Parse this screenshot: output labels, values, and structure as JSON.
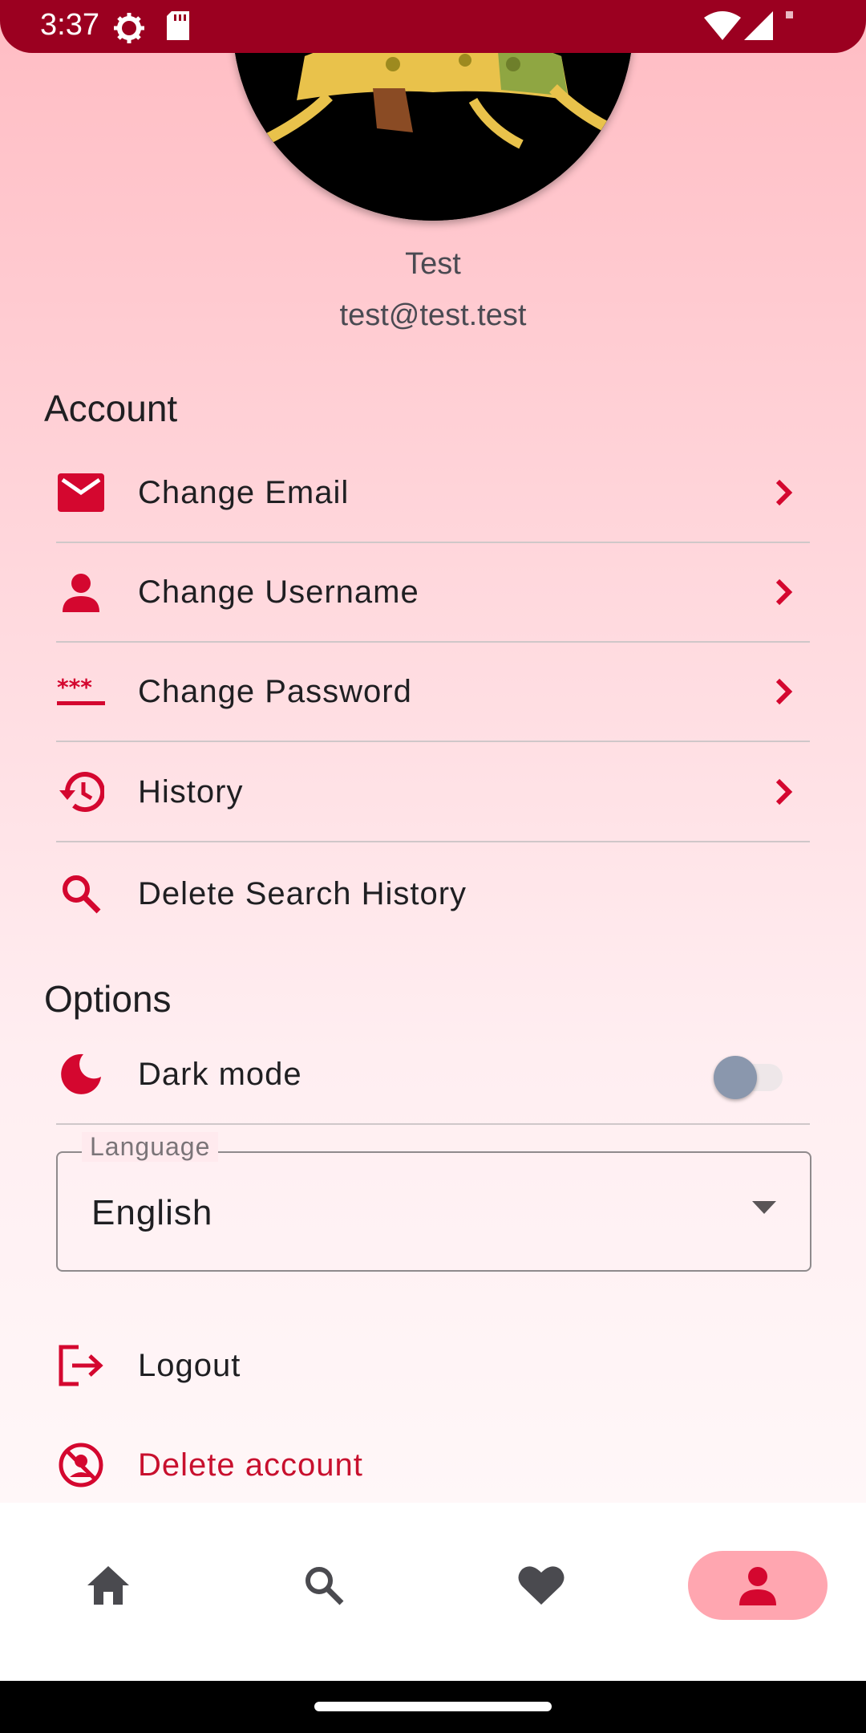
{
  "status_bar": {
    "time": "3:37"
  },
  "profile": {
    "name": "Test",
    "email": "test@test.test"
  },
  "account": {
    "title": "Account",
    "items": [
      {
        "label": "Change Email",
        "icon": "email-icon"
      },
      {
        "label": "Change Username",
        "icon": "person-icon"
      },
      {
        "label": "Change Password",
        "icon": "password-icon"
      },
      {
        "label": "History",
        "icon": "history-icon"
      },
      {
        "label": "Delete Search History",
        "icon": "search-icon"
      }
    ]
  },
  "options": {
    "title": "Options",
    "dark_mode_label": "Dark mode",
    "dark_mode_on": false,
    "language_label": "Language",
    "language_value": "English"
  },
  "actions": {
    "logout_label": "Logout",
    "delete_account_label": "Delete account"
  },
  "nav": [
    {
      "name": "home",
      "icon": "home-icon",
      "active": false
    },
    {
      "name": "search",
      "icon": "search-icon",
      "active": false
    },
    {
      "name": "favorites",
      "icon": "heart-icon",
      "active": false
    },
    {
      "name": "profile",
      "icon": "person-icon",
      "active": true
    }
  ],
  "colors": {
    "accent": "#d4072f",
    "status_bar": "#9b0020",
    "nav_active": "#ffa6b0"
  }
}
